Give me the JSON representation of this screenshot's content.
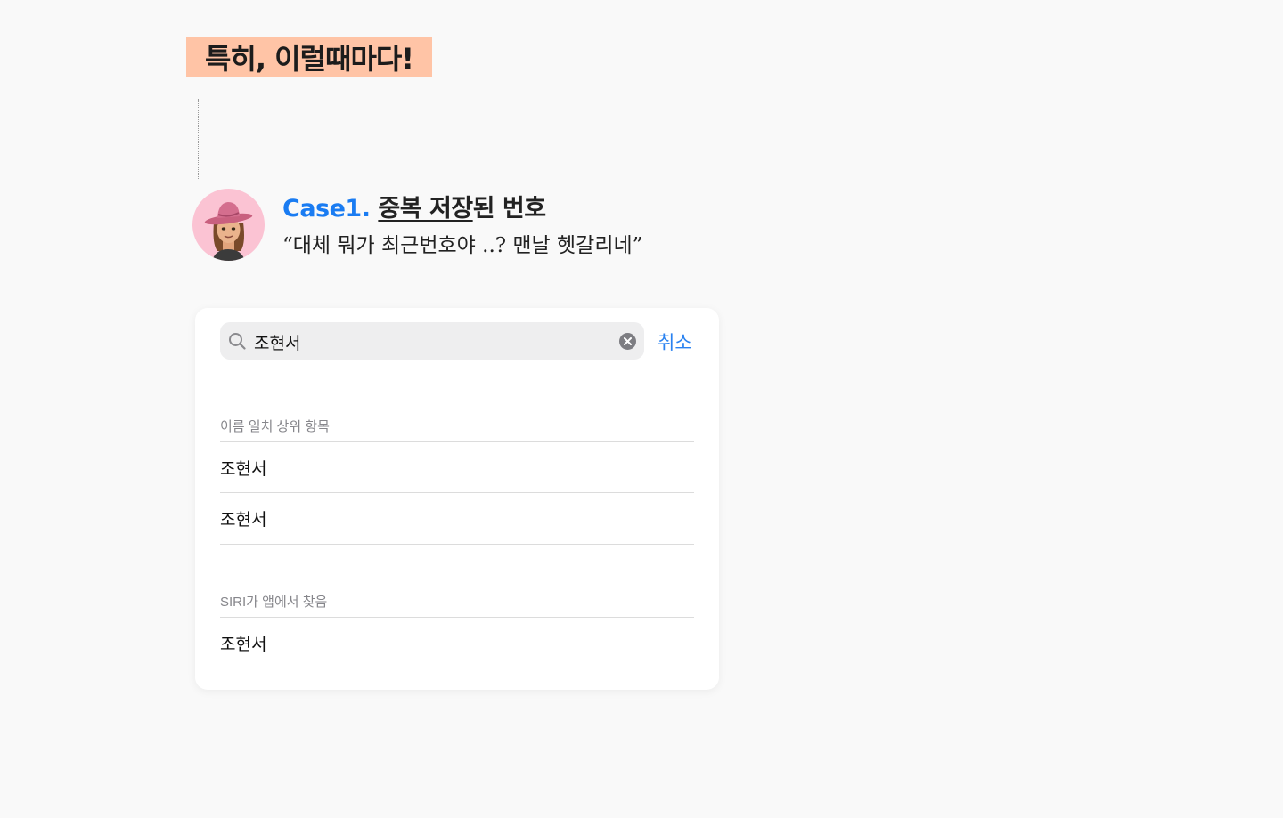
{
  "heading": "특히, 이럴때마다!",
  "case": {
    "prefix": "Case1.",
    "underlined": "중복 저장",
    "suffix": "된 번호",
    "quote": "“대체 뭐가 최근번호야 ..? 맨날 헷갈리네”"
  },
  "search": {
    "value": "조현서",
    "cancel_label": "취소"
  },
  "sections": [
    {
      "header": "이름 일치 상위 항목",
      "results": [
        "조현서",
        "조현서"
      ]
    },
    {
      "header": "SIRI가 앱에서 찾음",
      "results": [
        "조현서"
      ]
    }
  ],
  "colors": {
    "accent_blue": "#1a7cf2",
    "link_blue": "#2a82f0",
    "highlight": "#ffc4a6",
    "avatar_bg": "#fbc3d3"
  },
  "icons": {
    "avatar": "cowgirl-memoji-avatar",
    "search": "search-icon",
    "clear": "clear-icon"
  }
}
